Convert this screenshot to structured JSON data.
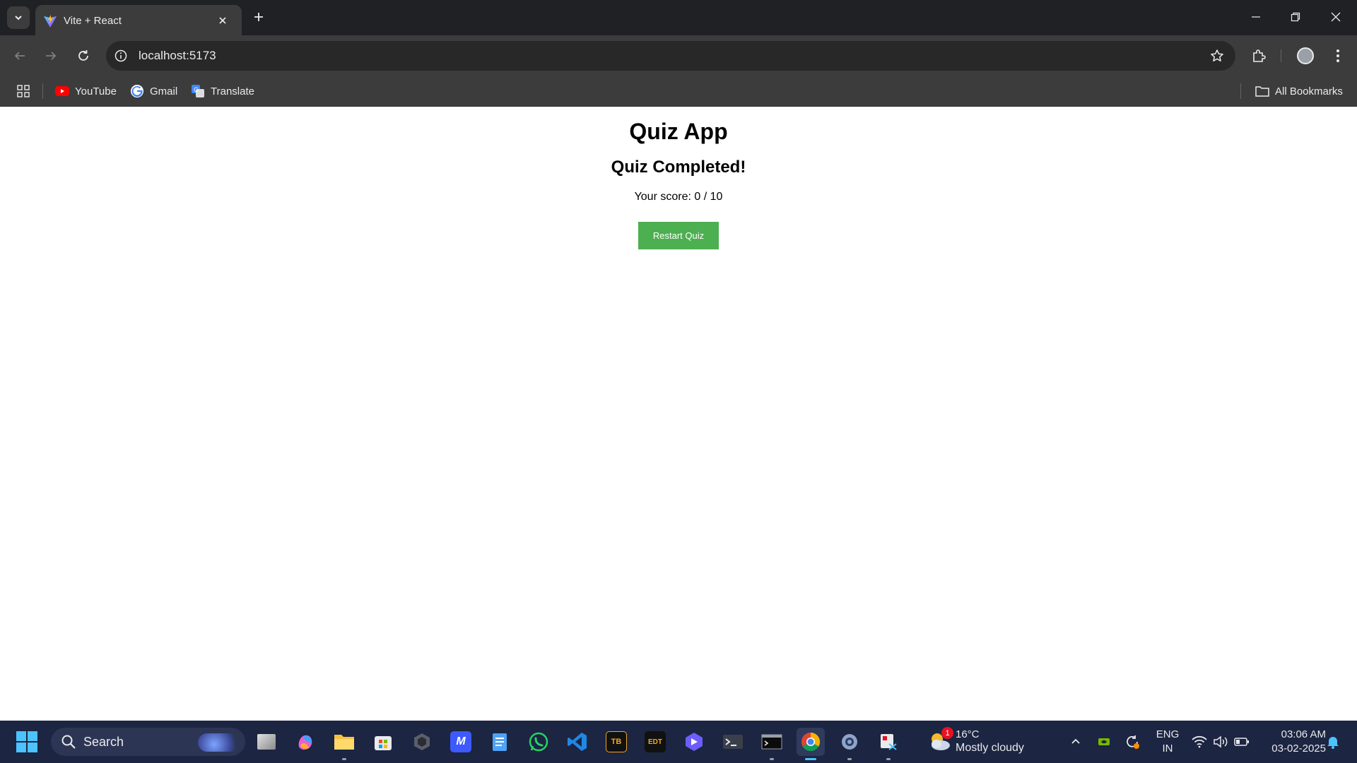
{
  "browser": {
    "tab": {
      "title": "Vite + React",
      "favicon": "vite-logo-icon"
    },
    "address": {
      "url": "localhost:5173"
    },
    "bookmarks": [
      {
        "label": "YouTube",
        "icon": "youtube-icon"
      },
      {
        "label": "Gmail",
        "icon": "google-icon"
      },
      {
        "label": "Translate",
        "icon": "translate-icon"
      }
    ],
    "all_bookmarks_label": "All Bookmarks"
  },
  "page": {
    "app_title": "Quiz App",
    "result_title": "Quiz Completed!",
    "score_label": "Your score:",
    "score_value": 0,
    "score_total": 10,
    "score_text": "Your score: 0 / 10",
    "restart_label": "Restart Quiz",
    "restart_color": "#4caf50"
  },
  "taskbar": {
    "search_placeholder": "Search",
    "apps": [
      "task-view-icon",
      "copilot-icon",
      "file-explorer-icon",
      "microsoft-store-icon",
      "dev-tool-icon",
      "app-icon",
      "notepad-icon",
      "whatsapp-icon",
      "vscode-icon",
      "tb-app-icon",
      "edt-app-icon",
      "app-icon",
      "terminal-icon",
      "command-prompt-icon",
      "chrome-icon",
      "settings-icon",
      "snipping-tool-icon"
    ],
    "weather": {
      "temp": "16°C",
      "desc": "Mostly cloudy",
      "badge": "1"
    },
    "language": {
      "line1": "ENG",
      "line2": "IN"
    },
    "clock": {
      "time": "03:06 AM",
      "date": "03-02-2025"
    }
  }
}
